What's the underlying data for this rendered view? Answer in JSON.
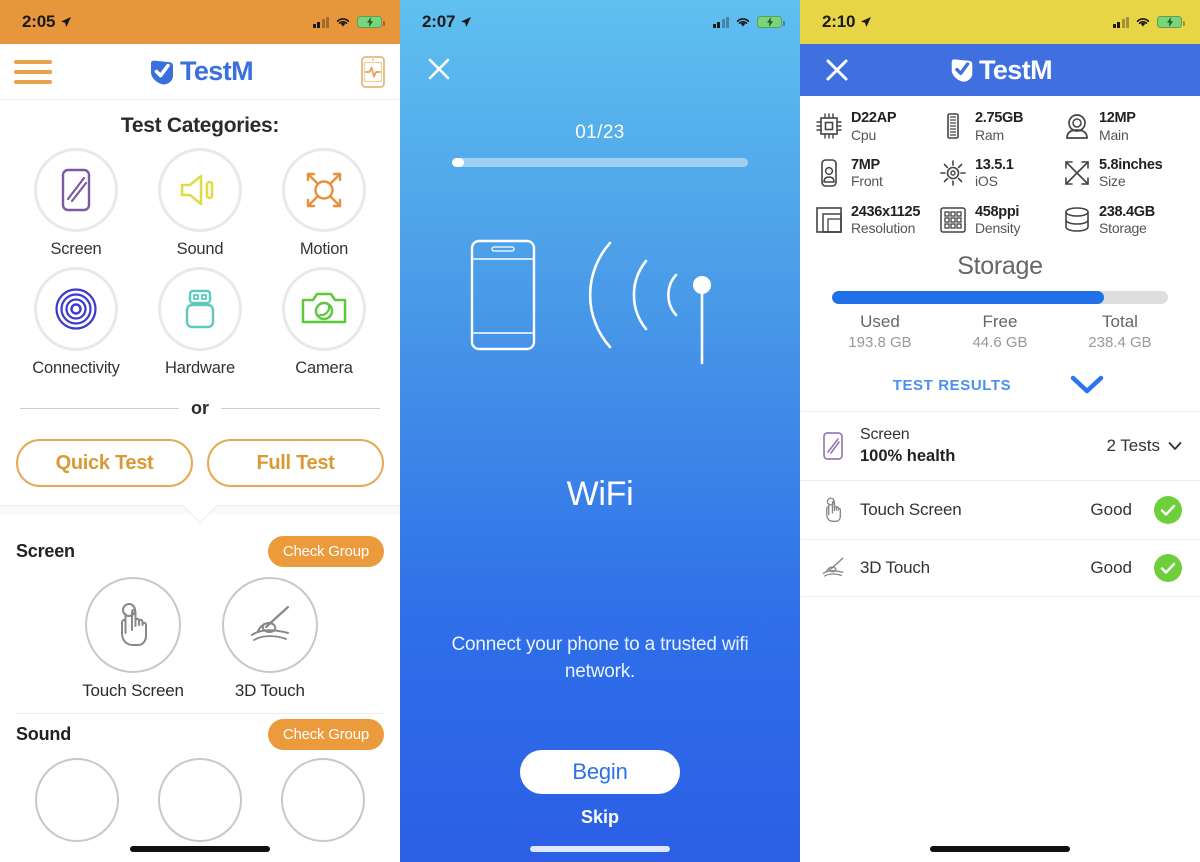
{
  "panel1": {
    "status": {
      "time": "2:05",
      "bar_color": "#e8963c"
    },
    "header": {
      "logo_text": "TestM",
      "menu_icon": "hamburger-menu-icon",
      "right_icon": "device-pulse-icon"
    },
    "categories_title": "Test Categories:",
    "categories": [
      {
        "label": "Screen",
        "icon": "screen-icon",
        "color": "#7a5aa0"
      },
      {
        "label": "Sound",
        "icon": "speaker-icon",
        "color": "#e3e04a"
      },
      {
        "label": "Motion",
        "icon": "motion-icon",
        "color": "#e8903c"
      },
      {
        "label": "Connectivity",
        "icon": "connectivity-icon",
        "color": "#3a3ad0"
      },
      {
        "label": "Hardware",
        "icon": "hardware-icon",
        "color": "#5fc8c0"
      },
      {
        "label": "Camera",
        "icon": "camera-icon",
        "color": "#5cc83c"
      }
    ],
    "or_label": "or",
    "quick_test": "Quick Test",
    "full_test": "Full Test",
    "groups": [
      {
        "name": "Screen",
        "check_group": "Check Group",
        "tests": [
          {
            "label": "Touch Screen",
            "icon": "touch-hand-icon"
          },
          {
            "label": "3D Touch",
            "icon": "three-d-touch-icon"
          }
        ]
      },
      {
        "name": "Sound",
        "check_group": "Check Group",
        "tests": []
      }
    ]
  },
  "panel2": {
    "status": {
      "time": "2:07"
    },
    "close_icon": "close-x-icon",
    "progress_label": "01/23",
    "progress_percent": 4,
    "illustration": "wifi-signal-icon",
    "test_name": "WiFi",
    "description": "Connect your phone to a trusted wifi network.",
    "begin_label": "Begin",
    "skip_label": "Skip"
  },
  "panel3": {
    "status": {
      "time": "2:10",
      "bar_color": "#e8d546"
    },
    "header": {
      "logo_text": "TestM",
      "close_icon": "close-x-icon",
      "bg_color": "#4070e0"
    },
    "specs": [
      {
        "value": "D22AP",
        "key": "Cpu",
        "icon": "cpu-chip-icon"
      },
      {
        "value": "2.75GB",
        "key": "Ram",
        "icon": "ram-stick-icon"
      },
      {
        "value": "12MP",
        "key": "Main",
        "icon": "main-camera-icon"
      },
      {
        "value": "7MP",
        "key": "Front",
        "icon": "front-camera-icon"
      },
      {
        "value": "13.5.1",
        "key": "iOS",
        "icon": "gear-icon"
      },
      {
        "value": "5.8inches",
        "key": "Size",
        "icon": "diagonal-size-icon"
      },
      {
        "value": "2436x1125",
        "key": "Resolution",
        "icon": "resolution-icon"
      },
      {
        "value": "458ppi",
        "key": "Density",
        "icon": "pixel-density-icon"
      },
      {
        "value": "238.4GB",
        "key": "Storage",
        "icon": "storage-disk-icon"
      }
    ],
    "storage": {
      "title": "Storage",
      "used_percent": 81,
      "columns": [
        {
          "label": "Used",
          "value": "193.8 GB"
        },
        {
          "label": "Free",
          "value": "44.6 GB"
        },
        {
          "label": "Total",
          "value": "238.4 GB"
        }
      ]
    },
    "test_results_link": "TEST RESULTS",
    "results": {
      "group": {
        "title": "Screen",
        "health": "100% health",
        "count": "2 Tests",
        "icon": "screen-icon"
      },
      "rows": [
        {
          "label": "Touch Screen",
          "status": "Good",
          "icon": "touch-hand-icon",
          "badge": "check-badge"
        },
        {
          "label": "3D Touch",
          "status": "Good",
          "icon": "three-d-touch-icon",
          "badge": "check-badge"
        }
      ]
    }
  }
}
